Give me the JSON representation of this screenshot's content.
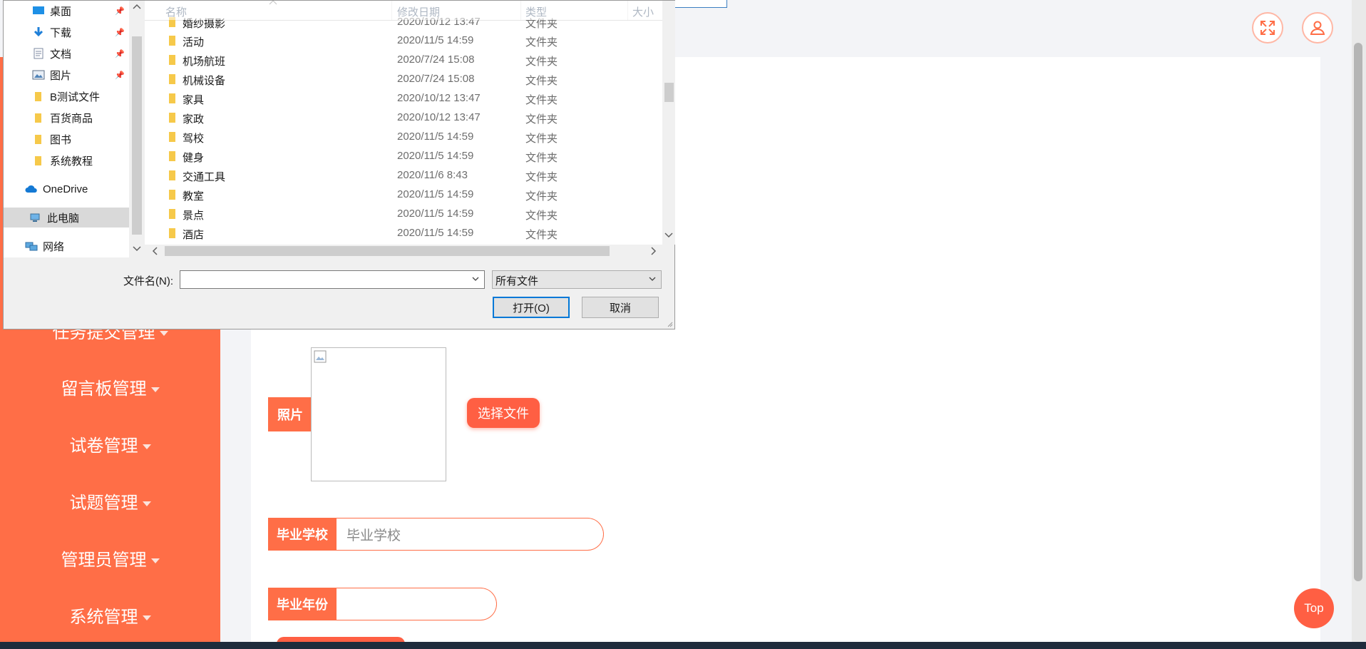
{
  "page": {
    "sidebar_items": [
      {
        "label": "任务提交管理"
      },
      {
        "label": "留言板管理"
      },
      {
        "label": "试卷管理"
      },
      {
        "label": "试题管理"
      },
      {
        "label": "管理员管理"
      },
      {
        "label": "系统管理"
      }
    ],
    "form": {
      "photo_label": "照片",
      "choose_file": "选择文件",
      "school_label": "毕业学校",
      "school_placeholder": "毕业学校",
      "year_label": "毕业年份",
      "year_value": ""
    },
    "top_button": "Top",
    "header_icons": [
      "fullscreen-icon",
      "user-icon"
    ],
    "accent_color": "#ff6e47"
  },
  "dialog": {
    "nav": [
      {
        "label": "桌面",
        "icon": "desktop-icon",
        "pinned": true
      },
      {
        "label": "下载",
        "icon": "download-icon",
        "pinned": true
      },
      {
        "label": "文档",
        "icon": "document-icon",
        "pinned": true
      },
      {
        "label": "图片",
        "icon": "picture-icon",
        "pinned": true
      },
      {
        "label": "B测试文件",
        "icon": "folder-icon",
        "pinned": false
      },
      {
        "label": "百货商品",
        "icon": "folder-icon",
        "pinned": false
      },
      {
        "label": "图书",
        "icon": "folder-icon",
        "pinned": false
      },
      {
        "label": "系统教程",
        "icon": "folder-icon",
        "pinned": false
      },
      {
        "label": "OneDrive",
        "icon": "cloud-icon",
        "pinned": false
      },
      {
        "label": "此电脑",
        "icon": "computer-icon",
        "pinned": false,
        "selected": true
      },
      {
        "label": "网络",
        "icon": "network-icon",
        "pinned": false
      }
    ],
    "columns": {
      "name": "名称",
      "date": "修改日期",
      "type": "类型",
      "size": "大小"
    },
    "files": [
      {
        "name": "婚纱摄影",
        "date": "2020/10/12 13:47",
        "type": "文件夹"
      },
      {
        "name": "活动",
        "date": "2020/11/5 14:59",
        "type": "文件夹"
      },
      {
        "name": "机场航班",
        "date": "2020/7/24 15:08",
        "type": "文件夹"
      },
      {
        "name": "机械设备",
        "date": "2020/7/24 15:08",
        "type": "文件夹"
      },
      {
        "name": "家具",
        "date": "2020/10/12 13:47",
        "type": "文件夹"
      },
      {
        "name": "家政",
        "date": "2020/10/12 13:47",
        "type": "文件夹"
      },
      {
        "name": "驾校",
        "date": "2020/11/5 14:59",
        "type": "文件夹"
      },
      {
        "name": "健身",
        "date": "2020/11/5 14:59",
        "type": "文件夹"
      },
      {
        "name": "交通工具",
        "date": "2020/11/6 8:43",
        "type": "文件夹"
      },
      {
        "name": "教室",
        "date": "2020/11/5 14:59",
        "type": "文件夹"
      },
      {
        "name": "景点",
        "date": "2020/11/5 14:59",
        "type": "文件夹"
      },
      {
        "name": "酒店",
        "date": "2020/11/5 14:59",
        "type": "文件夹"
      }
    ],
    "filename_label": "文件名(N):",
    "filename_value": "",
    "filter_value": "所有文件",
    "open_button": "打开(O)",
    "cancel_button": "取消"
  }
}
